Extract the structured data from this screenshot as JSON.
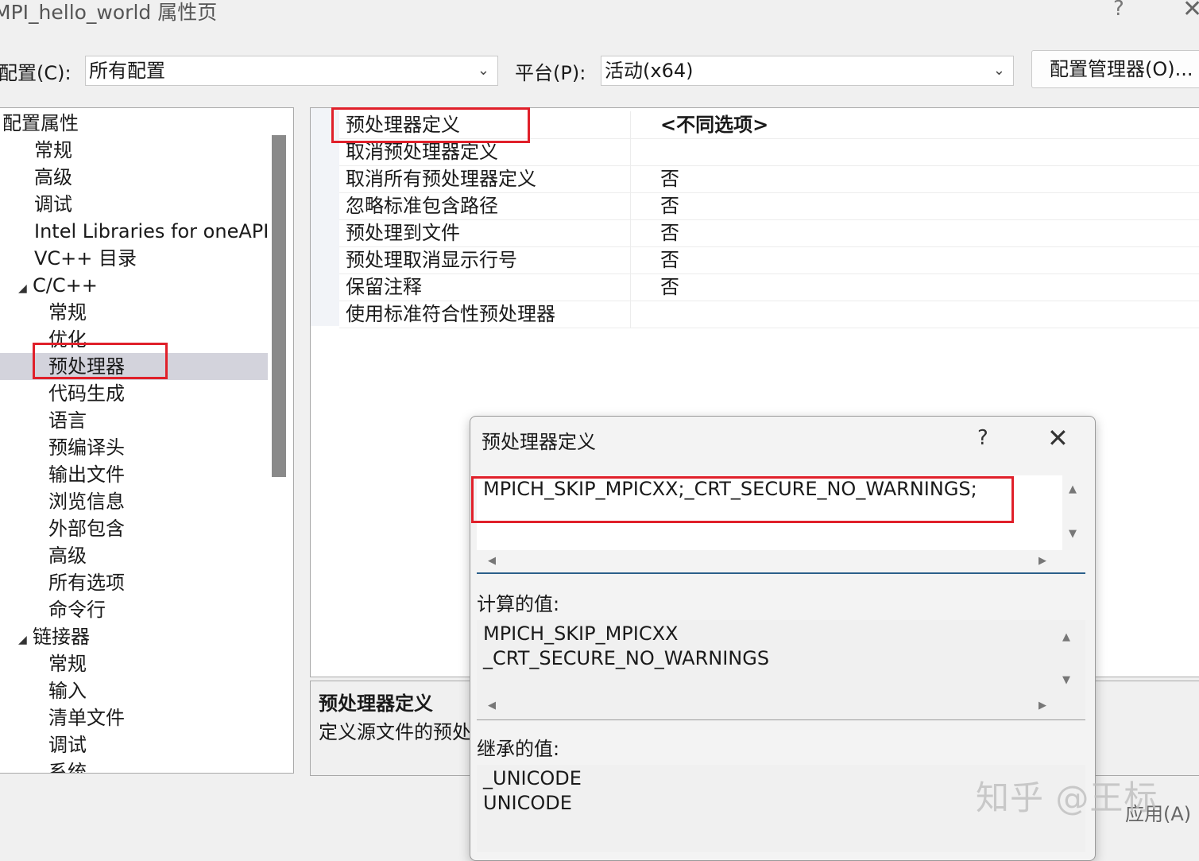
{
  "window": {
    "title": "MPI_hello_world 属性页",
    "help_glyph": "?",
    "close_glyph": "✕"
  },
  "config_bar": {
    "config_label": "配置(C):",
    "config_value": "所有配置",
    "platform_label": "平台(P):",
    "platform_value": "活动(x64)",
    "manager_button": "配置管理器(O)..."
  },
  "tree": {
    "items": [
      {
        "label": "配置属性",
        "level": 0,
        "expanded": true
      },
      {
        "label": "常规",
        "level": 1
      },
      {
        "label": "高级",
        "level": 1
      },
      {
        "label": "调试",
        "level": 1
      },
      {
        "label": "Intel Libraries for oneAPI",
        "level": 1
      },
      {
        "label": "VC++ 目录",
        "level": 1
      },
      {
        "label": "C/C++",
        "level": 1,
        "expanded": true
      },
      {
        "label": "常规",
        "level": 2
      },
      {
        "label": "优化",
        "level": 2
      },
      {
        "label": "预处理器",
        "level": 2,
        "selected": true
      },
      {
        "label": "代码生成",
        "level": 2
      },
      {
        "label": "语言",
        "level": 2
      },
      {
        "label": "预编译头",
        "level": 2
      },
      {
        "label": "输出文件",
        "level": 2
      },
      {
        "label": "浏览信息",
        "level": 2
      },
      {
        "label": "外部包含",
        "level": 2
      },
      {
        "label": "高级",
        "level": 2
      },
      {
        "label": "所有选项",
        "level": 2
      },
      {
        "label": "命令行",
        "level": 2
      },
      {
        "label": "链接器",
        "level": 1,
        "expanded": true
      },
      {
        "label": "常规",
        "level": 2
      },
      {
        "label": "输入",
        "level": 2
      },
      {
        "label": "清单文件",
        "level": 2
      },
      {
        "label": "调试",
        "level": 2
      },
      {
        "label": "系统",
        "level": 2
      }
    ]
  },
  "properties": {
    "rows": [
      {
        "name": "预处理器定义",
        "value": "<不同选项>",
        "bold": true
      },
      {
        "name": "取消预处理器定义",
        "value": ""
      },
      {
        "name": "取消所有预处理器定义",
        "value": "否"
      },
      {
        "name": "忽略标准包含路径",
        "value": "否"
      },
      {
        "name": "预处理到文件",
        "value": "否"
      },
      {
        "name": "预处理取消显示行号",
        "value": "否"
      },
      {
        "name": "保留注释",
        "value": "否"
      },
      {
        "name": "使用标准符合性预处理器",
        "value": ""
      }
    ]
  },
  "description": {
    "title": "预处理器定义",
    "text": "定义源文件的预处"
  },
  "apply_button": "应用(A)",
  "dialog": {
    "title": "预处理器定义",
    "help_glyph": "?",
    "close_glyph": "✕",
    "edit_value": "MPICH_SKIP_MPICXX;_CRT_SECURE_NO_WARNINGS;",
    "computed_label": "计算的值:",
    "computed_lines": [
      "MPICH_SKIP_MPICXX",
      "_CRT_SECURE_NO_WARNINGS"
    ],
    "inherited_label": "继承的值:",
    "inherited_lines": [
      "_UNICODE",
      "UNICODE"
    ]
  },
  "watermark": "知乎 @王标",
  "colors": {
    "highlight_red": "#e0202a",
    "selection": "#d3d3dc"
  }
}
